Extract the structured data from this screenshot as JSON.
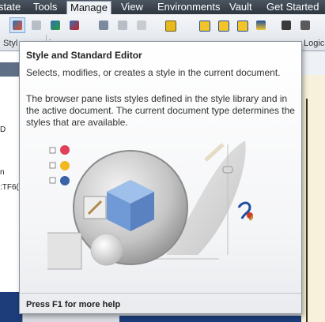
{
  "tabs": [
    {
      "label": "state",
      "active": false
    },
    {
      "label": "Tools",
      "active": false
    },
    {
      "label": "Manage",
      "active": true
    },
    {
      "label": "View",
      "active": false
    },
    {
      "label": "Environments",
      "active": false
    },
    {
      "label": "Vault",
      "active": false
    },
    {
      "label": "Get Started",
      "active": false
    }
  ],
  "ribbon": {
    "panel_labels": [
      "Styl",
      "i",
      "Logic"
    ]
  },
  "left_pane": {
    "texts": [
      "D",
      "n",
      ":TF6("
    ]
  },
  "tooltip": {
    "title": "Style and Standard Editor",
    "subtitle": "Selects, modifies, or creates a style in the current document.",
    "body": "The browser pane lists styles defined in the style library and in the active document. The current document type determines the styles that are available.",
    "footer": "Press F1 for more help"
  },
  "colors": {
    "tab_bar": "#3a434d",
    "tooltip_border": "#8e959d",
    "selected_button": "#cfe3f7",
    "document_blue": "#1c3d7a"
  }
}
